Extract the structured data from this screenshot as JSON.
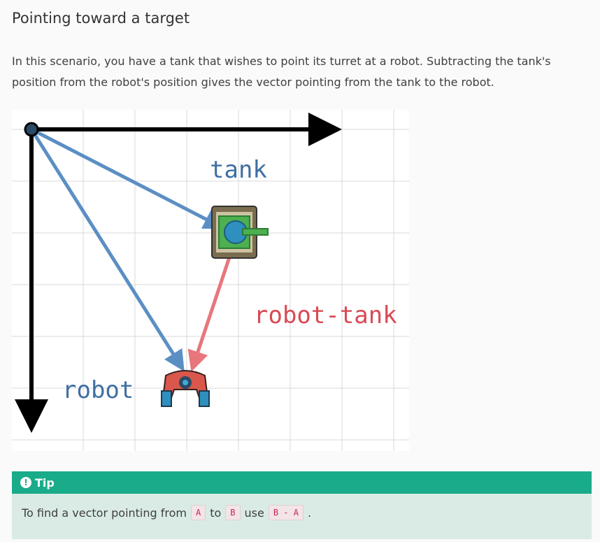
{
  "page": {
    "title": "Pointing toward a target",
    "intro": "In this scenario, you have a tank that wishes to point its turret at a robot. Subtracting the tank's position from the robot's position gives the vector pointing from the tank to the robot."
  },
  "figure": {
    "labels": {
      "tank": "tank",
      "robot": "robot",
      "difference": "robot-tank"
    },
    "colors": {
      "position_vector": "#5b8fc4",
      "difference_vector": "#e8767c",
      "axes": "#000000",
      "grid": "#d9d9d9"
    },
    "icons": [
      "tank-sprite",
      "robot-sprite",
      "origin-dot"
    ]
  },
  "tip": {
    "icon": "info-icon",
    "title": "Tip",
    "text_before": "To find a vector pointing from",
    "code_a": "A",
    "text_mid": "to",
    "code_b": "B",
    "text_use": "use",
    "code_expr": "B - A",
    "text_end": ".",
    "colors": {
      "header": "#1aab8a",
      "body": "#d9ebe4"
    }
  }
}
